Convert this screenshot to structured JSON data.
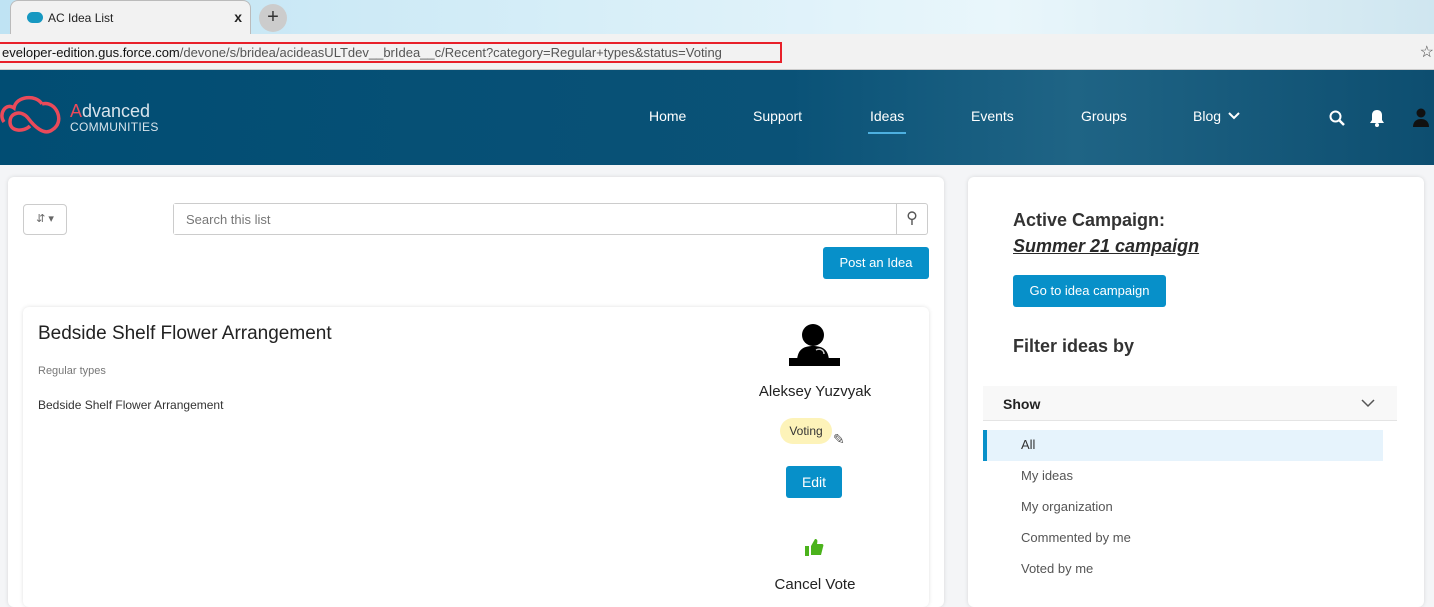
{
  "browser": {
    "tab_title": "AC Idea List",
    "url_host": "eveloper-edition.gus.force.com",
    "url_path": "/devone/s/bridea/acideasULTdev__brIdea__c/Recent?category=Regular+types&status=Voting",
    "close": "x",
    "new_tab": "+"
  },
  "header": {
    "logo_first": "A",
    "logo_rest": "dvanced",
    "logo_sub": "COMMUNITIES",
    "nav": [
      "Home",
      "Support",
      "Ideas",
      "Events",
      "Groups",
      "Blog"
    ],
    "active": "Ideas"
  },
  "list": {
    "search_placeholder": "Search this list",
    "post_button": "Post an Idea"
  },
  "idea": {
    "title": "Bedside Shelf Flower Arrangement",
    "category": "Regular types",
    "description": "Bedside Shelf Flower Arrangement",
    "author": "Aleksey Yuzvyak",
    "status": "Voting",
    "edit": "Edit",
    "cancel_vote": "Cancel Vote"
  },
  "sidebar": {
    "campaign_heading": "Active Campaign:",
    "campaign_name": "Summer 21 campaign",
    "campaign_button": "Go to idea campaign",
    "filter_heading": "Filter ideas by",
    "show_label": "Show",
    "filters": [
      "All",
      "My ideas",
      "My organization",
      "Commented by me",
      "Voted by me"
    ],
    "selected": "All"
  },
  "colors": {
    "accent": "#0790c9",
    "header": "#014d73",
    "badge": "#fdf3b9",
    "vote": "#4bb31c",
    "logo": "#ea4a5a"
  }
}
